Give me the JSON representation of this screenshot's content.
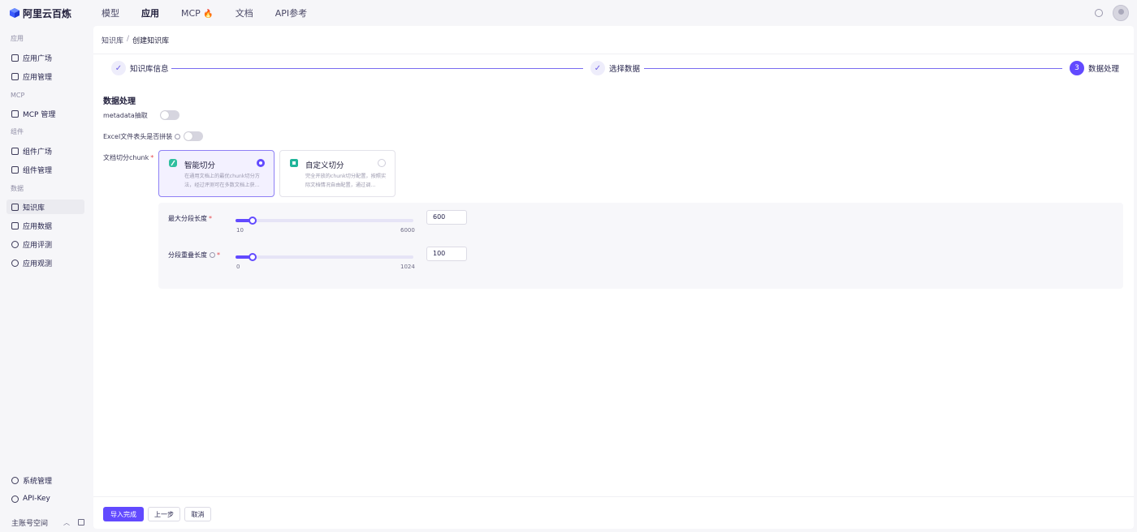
{
  "brand": {
    "name": "阿里云百炼"
  },
  "topnav": [
    "模型",
    "应用",
    "MCP",
    "文档",
    "API参考"
  ],
  "topnav_fire": "🔥",
  "sidebar": {
    "groups": [
      "应用",
      "MCP",
      "组件",
      "数据"
    ],
    "items": [
      "应用广场",
      "应用管理",
      "MCP 管理",
      "组件广场",
      "组件管理",
      "知识库",
      "应用数据",
      "应用评测",
      "应用观测"
    ],
    "bottom": [
      "系统管理",
      "API-Key"
    ],
    "workspace": "主账号空间"
  },
  "breadcrumb": {
    "parent": "知识库",
    "separator": "/",
    "current": "创建知识库"
  },
  "steps": [
    {
      "label": "知识库信息",
      "mark": "✓"
    },
    {
      "label": "选择数据",
      "mark": "✓"
    },
    {
      "label": "数据处理",
      "mark": "3"
    }
  ],
  "form": {
    "section_title": "数据处理",
    "metadata_label": "metadata抽取",
    "metadata_on": false,
    "excel_label": "Excel文件表头是否拼装",
    "excel_on": false,
    "chunk_label": "文档切分chunk",
    "required_mark": "*",
    "chunk_options": [
      {
        "title": "智能切分",
        "desc": "在通用文档上的最优chunk切分方法，经过评测可在多数文档上获...",
        "selected": true
      },
      {
        "title": "自定义切分",
        "desc": "完全开放的chunk切分配置，按照实际文档情况自由配置，通过调...",
        "selected": false
      }
    ]
  },
  "params": {
    "max_len": {
      "label": "最大分段长度",
      "min": "10",
      "max": "6000",
      "value": "600"
    },
    "overlap": {
      "label": "分段重叠长度",
      "min": "0",
      "max": "1024",
      "value": "100"
    }
  },
  "buttons": {
    "submit": "导入完成",
    "prev": "上一步",
    "cancel": "取消"
  },
  "colors": {
    "accent": "#624aff"
  }
}
